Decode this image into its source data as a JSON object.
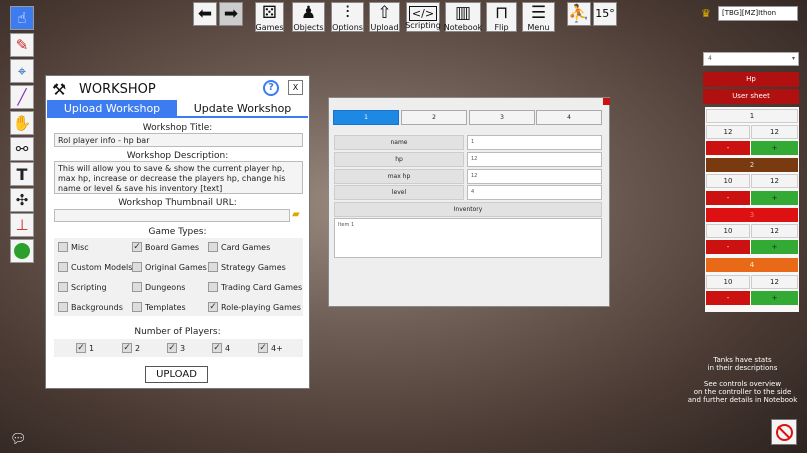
{
  "colors": {
    "accent": "#3d7cf0",
    "red": "#cc1111",
    "green": "#33aa33",
    "darkred": "#b01010",
    "brown": "#7a3a10",
    "orange": "#e86a18"
  },
  "toolbar": {
    "items": [
      {
        "label": "Games",
        "icon": "dice-icon"
      },
      {
        "label": "Objects",
        "icon": "pawn-icon"
      },
      {
        "label": "Options",
        "icon": "sliders-icon"
      },
      {
        "label": "Upload",
        "icon": "upload-icon"
      },
      {
        "label": "Scripting",
        "icon": "code-icon"
      },
      {
        "label": "Notebook",
        "icon": "notebook-icon"
      },
      {
        "label": "Flip",
        "icon": "flip-table-icon"
      },
      {
        "label": "Menu",
        "icon": "menu-icon"
      }
    ],
    "rotation": "15°"
  },
  "user": {
    "name": "[TBG][MZ]Ithon"
  },
  "workshop": {
    "title": "WORKSHOP",
    "help": "?",
    "close": "X",
    "tab_upload": "Upload Workshop",
    "tab_update": "Update Workshop",
    "title_label": "Workshop Title:",
    "title_value": "Rol player info - hp bar",
    "desc_label": "Workshop Description:",
    "desc_value": "This will allow you to save & show the current player hp, max hp, increase or decrease the players hp, change his name or level & save his inventory [text]",
    "thumb_label": "Workshop Thumbnail URL:",
    "thumb_value": "",
    "game_types_label": "Game Types:",
    "game_types": [
      {
        "label": "Misc",
        "checked": false
      },
      {
        "label": "Board Games",
        "checked": true
      },
      {
        "label": "Card Games",
        "checked": false
      },
      {
        "label": "Custom Models",
        "checked": false
      },
      {
        "label": "Original Games",
        "checked": false
      },
      {
        "label": "Strategy Games",
        "checked": false
      },
      {
        "label": "Scripting",
        "checked": false
      },
      {
        "label": "Dungeons",
        "checked": false
      },
      {
        "label": "Trading Card Games",
        "checked": false
      },
      {
        "label": "Backgrounds",
        "checked": false
      },
      {
        "label": "Templates",
        "checked": false
      },
      {
        "label": "Role-playing Games",
        "checked": true
      }
    ],
    "players_label": "Number of Players:",
    "players": [
      {
        "label": "1",
        "checked": true
      },
      {
        "label": "2",
        "checked": true
      },
      {
        "label": "3",
        "checked": true
      },
      {
        "label": "4",
        "checked": true
      },
      {
        "label": "4+",
        "checked": true
      }
    ],
    "upload_button": "UPLOAD"
  },
  "statpanel": {
    "tabs": [
      "1",
      "2",
      "3",
      "4"
    ],
    "fields": [
      {
        "label": "name",
        "value": "1"
      },
      {
        "label": "hp",
        "value": "12"
      },
      {
        "label": "max hp",
        "value": "12"
      },
      {
        "label": "level",
        "value": "4"
      }
    ],
    "inventory_label": "Inventory",
    "inventory_value": "Item 1"
  },
  "rightpanel": {
    "select_value": "4",
    "hp_button": "Hp",
    "usersheet_button": "User sheet",
    "players": [
      {
        "name": "1",
        "hp": "12",
        "max": "12",
        "color": "#f4f4f4"
      },
      {
        "name": "2",
        "hp": "10",
        "max": "12",
        "color": "#7a3a10"
      },
      {
        "name": "3",
        "hp": "10",
        "max": "12",
        "color": "#cc1111"
      },
      {
        "name": "4",
        "hp": "10",
        "max": "12",
        "color": "#e86a18"
      }
    ],
    "minus": "-",
    "plus": "+"
  },
  "notes": {
    "line1": "Tanks have stats",
    "line2": "in their descriptions",
    "line3": "See controls overview",
    "line4": "on the controller to the side",
    "line5": "and further details in Notebook"
  }
}
